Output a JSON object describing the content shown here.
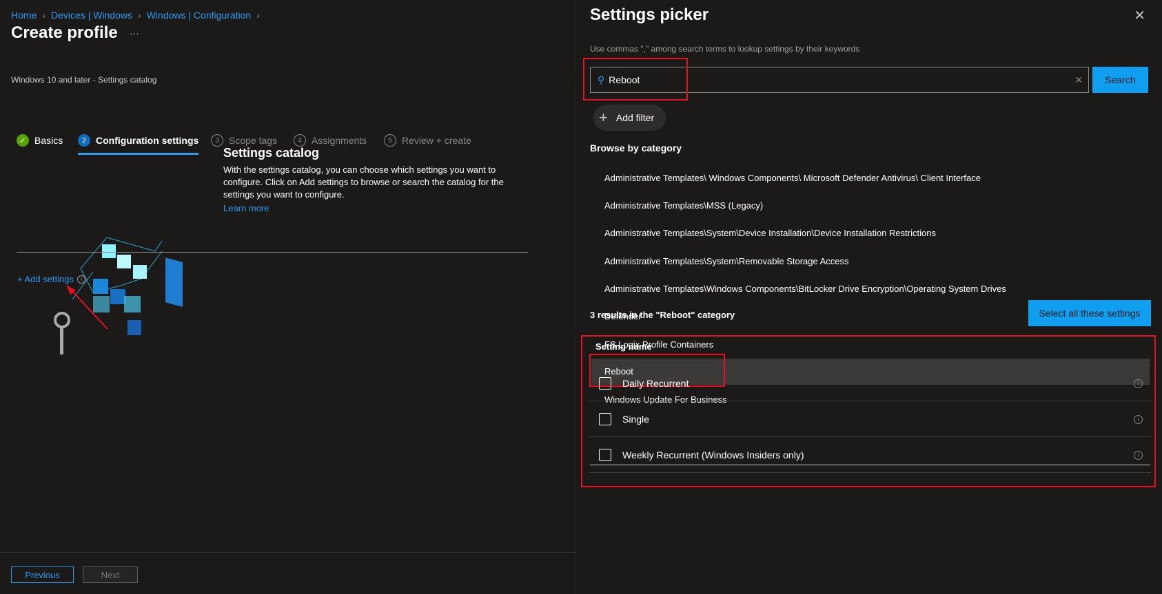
{
  "breadcrumb": [
    "Home",
    "Devices | Windows",
    "Windows | Configuration"
  ],
  "page": {
    "title": "Create profile",
    "more": "···",
    "subtitle": "Windows 10 and later - Settings catalog"
  },
  "tabs": [
    {
      "num": "✓",
      "label": "Basics",
      "state": "done"
    },
    {
      "num": "2",
      "label": "Configuration settings",
      "state": "active"
    },
    {
      "num": "3",
      "label": "Scope tags",
      "state": "inactive"
    },
    {
      "num": "4",
      "label": "Assignments",
      "state": "inactive"
    },
    {
      "num": "5",
      "label": "Review + create",
      "state": "inactive"
    }
  ],
  "catalog": {
    "heading": "Settings catalog",
    "description": "With the settings catalog, you can choose which settings you want to configure. Click on Add settings to browse or search the catalog for the settings you want to configure.",
    "learn_more": "Learn more"
  },
  "add_settings": "+ Add settings",
  "footer": {
    "previous": "Previous",
    "next": "Next"
  },
  "picker": {
    "title": "Settings picker",
    "hint": "Use commas \",\" among search terms to lookup settings by their keywords",
    "search_value": "Reboot",
    "search_button": "Search",
    "add_filter": "Add filter",
    "browse_heading": "Browse by category",
    "categories": [
      "Administrative Templates\\ Windows Components\\ Microsoft Defender Antivirus\\ Client Interface",
      "Administrative Templates\\MSS (Legacy)",
      "Administrative Templates\\System\\Device Installation\\Device Installation Restrictions",
      "Administrative Templates\\System\\Removable Storage Access",
      "Administrative Templates\\Windows Components\\BitLocker Drive Encryption\\Operating System Drives",
      "Defender",
      "FS Logix Profile Containers",
      "Reboot",
      "Windows Update For Business"
    ],
    "selected_category": "Reboot",
    "results_text": "3 results in the \"Reboot\" category",
    "select_all": "Select all these settings",
    "column_header": "Setting name",
    "settings": [
      "Daily Recurrent",
      "Single",
      "Weekly Recurrent (Windows Insiders only)"
    ]
  },
  "colors": {
    "accent": "#2b9bf4",
    "button": "#0f9ef0",
    "highlight": "#e81123"
  }
}
